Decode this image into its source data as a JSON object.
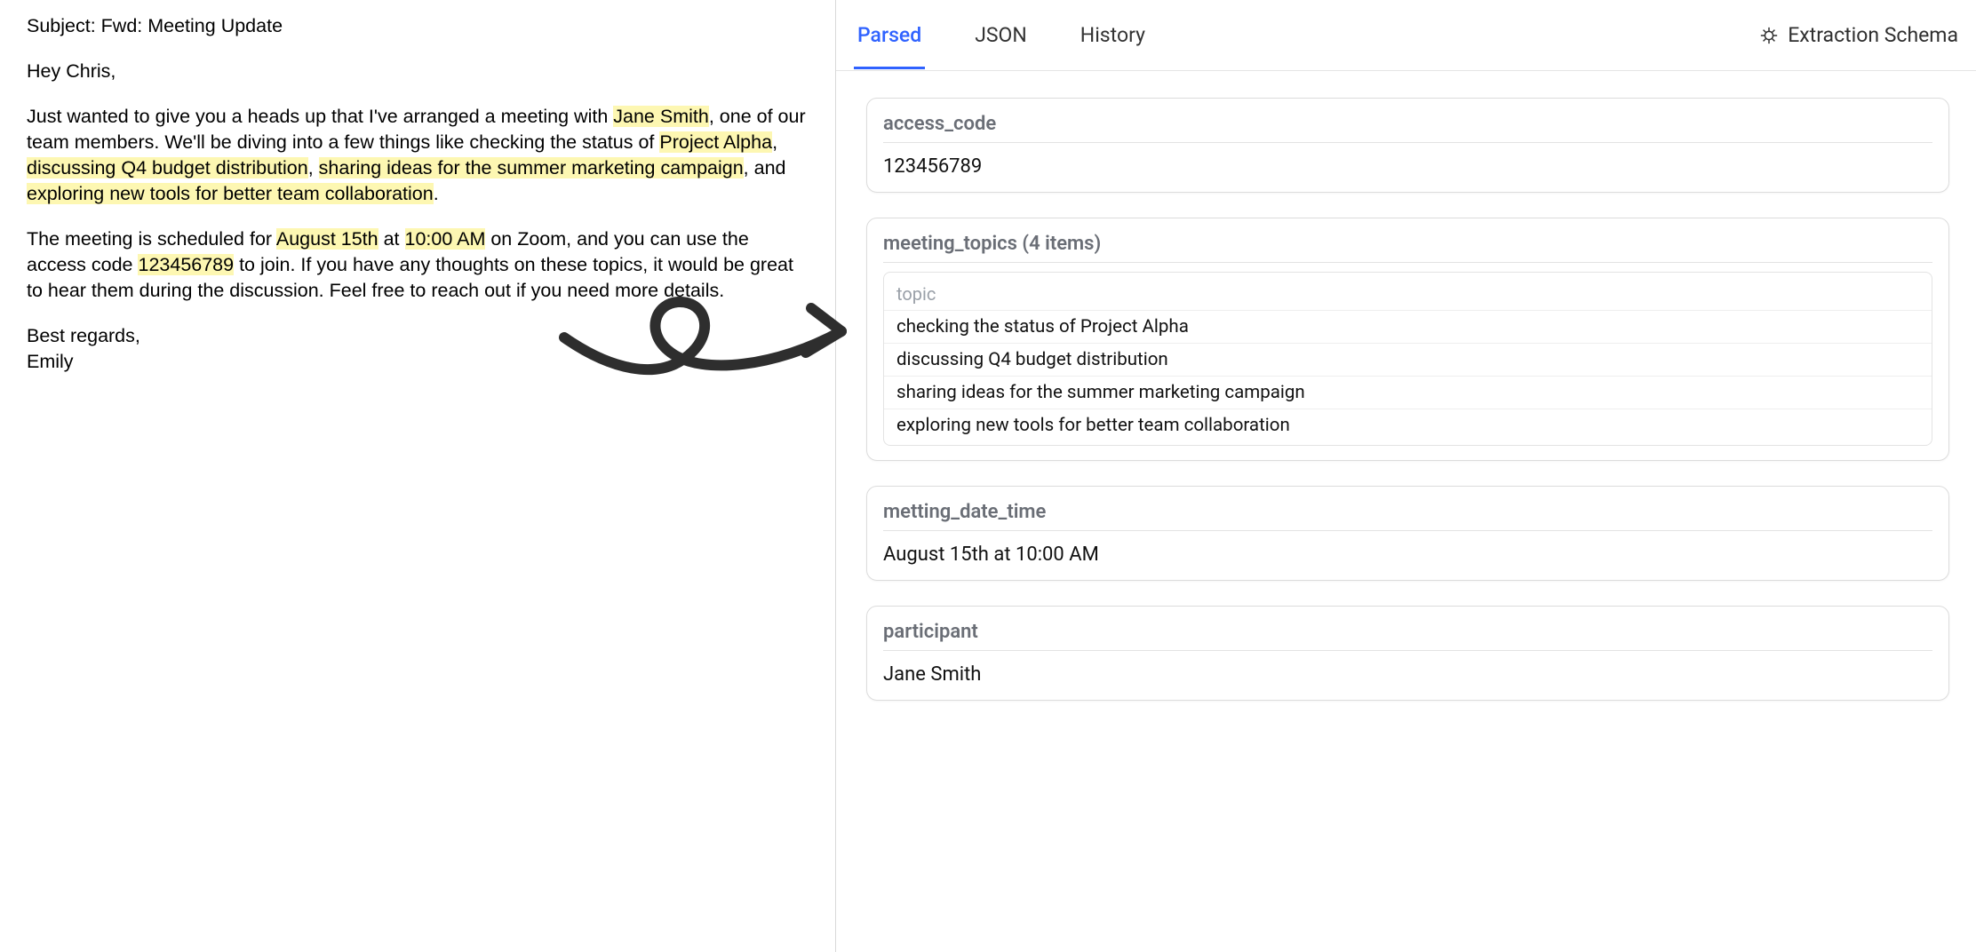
{
  "email": {
    "subject_label": "Subject: ",
    "subject": "Fwd: Meeting Update",
    "greeting": "Hey Chris,",
    "p1": {
      "t0": "Just wanted to give you a heads up that I've arranged a meeting with ",
      "h0": "Jane Smith",
      "t1": ", one of our team members. We'll be diving into a few things like checking the status of ",
      "h1": "Project Alpha",
      "t2": ", ",
      "h2": "discussing Q4 budget distribution",
      "t3": ", ",
      "h3": "sharing ideas for the summer marketing campaign",
      "t4": ", and ",
      "h4": "exploring new tools for better team collaboration",
      "t5": "."
    },
    "p2": {
      "t0": "The meeting is scheduled for ",
      "h0": "August 15th",
      "t1": " at ",
      "h1": "10:00 AM",
      "t2": " on Zoom, and you can use the access code ",
      "h2": "123456789",
      "t3": " to join. If you have any thoughts on these topics, it would be great to hear them during the discussion. Feel free to reach out if you need more details."
    },
    "signoff": "Best regards,",
    "sender": "Emily"
  },
  "tabs": {
    "parsed": "Parsed",
    "json": "JSON",
    "history": "History",
    "schema": "Extraction Schema"
  },
  "fields": {
    "access_code": {
      "label": "access_code",
      "value": "123456789"
    },
    "meeting_topics": {
      "label": "meeting_topics (4 items)",
      "column": "topic",
      "items": [
        "checking the status of Project Alpha",
        "discussing Q4 budget distribution",
        "sharing ideas for the summer marketing campaign",
        "exploring new tools for better team collaboration"
      ]
    },
    "metting_date_time": {
      "label": "metting_date_time",
      "value": "August 15th at 10:00 AM"
    },
    "participant": {
      "label": "participant",
      "value": "Jane Smith"
    }
  }
}
